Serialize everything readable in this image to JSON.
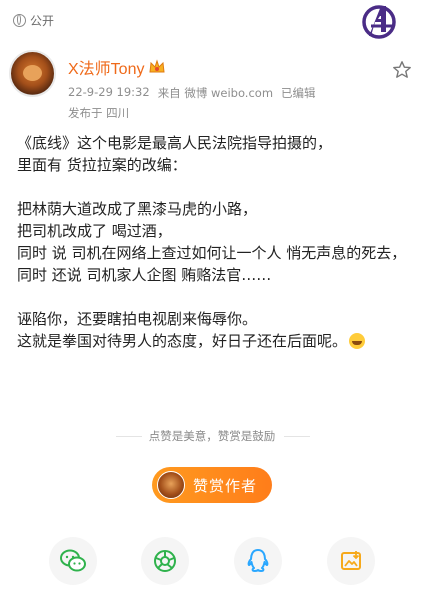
{
  "visibility": {
    "label": "公开",
    "icon": "globe-icon"
  },
  "brand_logo": "avengers-logo",
  "author": {
    "name": "X法师Tony",
    "badge_icon": "crown-icon",
    "avatar": "avatar"
  },
  "meta": {
    "datetime": "22-9-29 19:32",
    "source": "来自 微博 weibo.com",
    "edited": "已编辑",
    "location": "发布于 四川"
  },
  "post": {
    "lines": [
      "《底线》这个电影是最高人民法院指导拍摄的，",
      "里面有 货拉拉案的改编：",
      "把林荫大道改成了黑漆马虎的小路，",
      "把司机改成了 喝过酒，",
      "同时 说 司机在网络上查过如何让一个人 悄无声息的死去，",
      "同时 还说 司机家人企图 贿赂法官……",
      "诬陷你，还要瞎拍电视剧来侮辱你。",
      "这就是拳国对待男人的态度，好日子还在后面呢。"
    ]
  },
  "encourage_text": "点赞是美意，赞赏是鼓励",
  "tip_button": {
    "label": "赞赏作者"
  },
  "share_icons": [
    "wechat-icon",
    "moments-icon",
    "qq-icon",
    "save-image-icon"
  ],
  "colors": {
    "username": "#ef6a1a",
    "tip_button": "#ff8a1c",
    "wechat": "#2fb24c",
    "qq": "#2aa7ff",
    "save": "#f6a91b"
  }
}
